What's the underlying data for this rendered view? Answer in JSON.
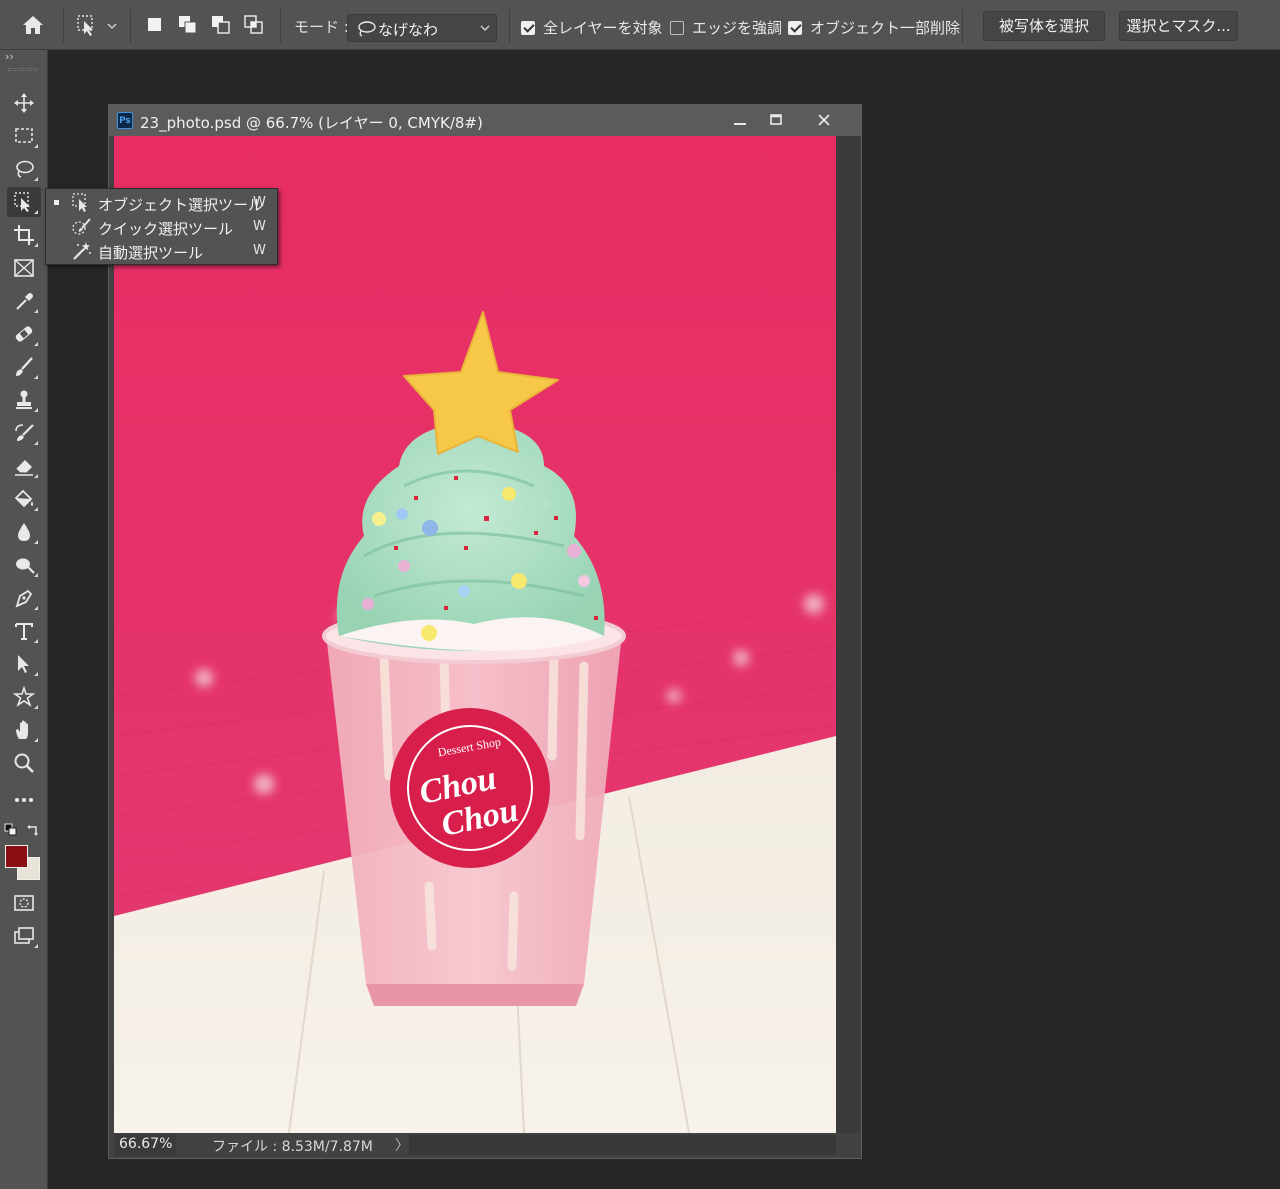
{
  "options_bar": {
    "mode_label": "モード :",
    "mode_value": "なげなわ",
    "sample_all_layers": {
      "label": "全レイヤーを対象",
      "checked": true
    },
    "enhance_edge": {
      "label": "エッジを強調",
      "checked": false
    },
    "object_subtract": {
      "label": "オブジェクト一部削除",
      "checked": true
    },
    "select_subject_label": "被写体を選択",
    "select_and_mask_label": "選択とマスク..."
  },
  "toolbar": {
    "collapse_glyph": "››",
    "tools": [
      "move-tool",
      "rectangular-marquee-tool",
      "lasso-tool",
      "object-selection-tool",
      "crop-tool",
      "frame-tool",
      "eyedropper-tool",
      "healing-brush-tool",
      "brush-tool",
      "clone-stamp-tool",
      "history-brush-tool",
      "eraser-tool",
      "paint-bucket-tool",
      "blur-tool",
      "dodge-tool",
      "pen-tool",
      "type-tool",
      "path-selection-tool",
      "custom-shape-tool",
      "hand-tool",
      "zoom-tool",
      "edit-toolbar",
      "quick-mask",
      "screen-mode"
    ],
    "foreground_color": "#8a0f12",
    "background_color": "#e9e2d6"
  },
  "flyout": {
    "items": [
      {
        "label": "オブジェクト選択ツール",
        "shortcut": "W",
        "active": true
      },
      {
        "label": "クイック選択ツール",
        "shortcut": "W",
        "active": false
      },
      {
        "label": "自動選択ツール",
        "shortcut": "W",
        "active": false
      }
    ]
  },
  "document": {
    "ps_badge": "Ps",
    "title": "23_photo.psd @ 66.7% (レイヤー 0, CMYK/8#)",
    "zoom": "66.67%",
    "file_info": "ファイル : 8.53M/7.87M",
    "status_arrow": "〉"
  },
  "photo": {
    "badge_top": "Dessert Shop",
    "badge_line1": "Chou",
    "badge_line2": "Chou",
    "colors": {
      "wall": "#e8316b",
      "floor": "#f3eee6",
      "cream": "#a8dcc0",
      "star": "#f7c84a",
      "cup": "#f4b7c3",
      "badge": "#d81e4b"
    }
  }
}
